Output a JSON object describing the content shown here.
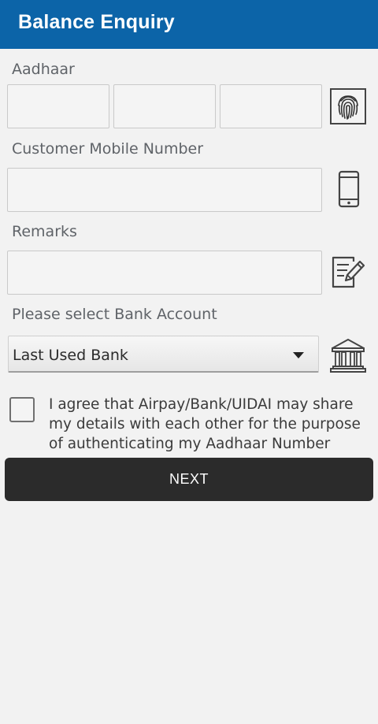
{
  "appbar": {
    "title": "Balance Enquiry",
    "color": "#0c64a8"
  },
  "form": {
    "aadhaar": {
      "label": "Aadhaar",
      "values": [
        "",
        "",
        ""
      ],
      "icon": "fingerprint-icon"
    },
    "mobile": {
      "label": "Customer Mobile Number",
      "value": "",
      "icon": "mobile-phone-icon"
    },
    "remarks": {
      "label": "Remarks",
      "value": "",
      "icon": "edit-note-icon"
    },
    "bank": {
      "label": "Please select Bank Account",
      "selected": "Last Used Bank",
      "icon": "bank-icon"
    },
    "consent": {
      "checked": false,
      "text": "I agree that Airpay/Bank/UIDAI may share my details with each other for the purpose of authenticating my Aadhaar Number"
    },
    "next_label": "NEXT"
  }
}
